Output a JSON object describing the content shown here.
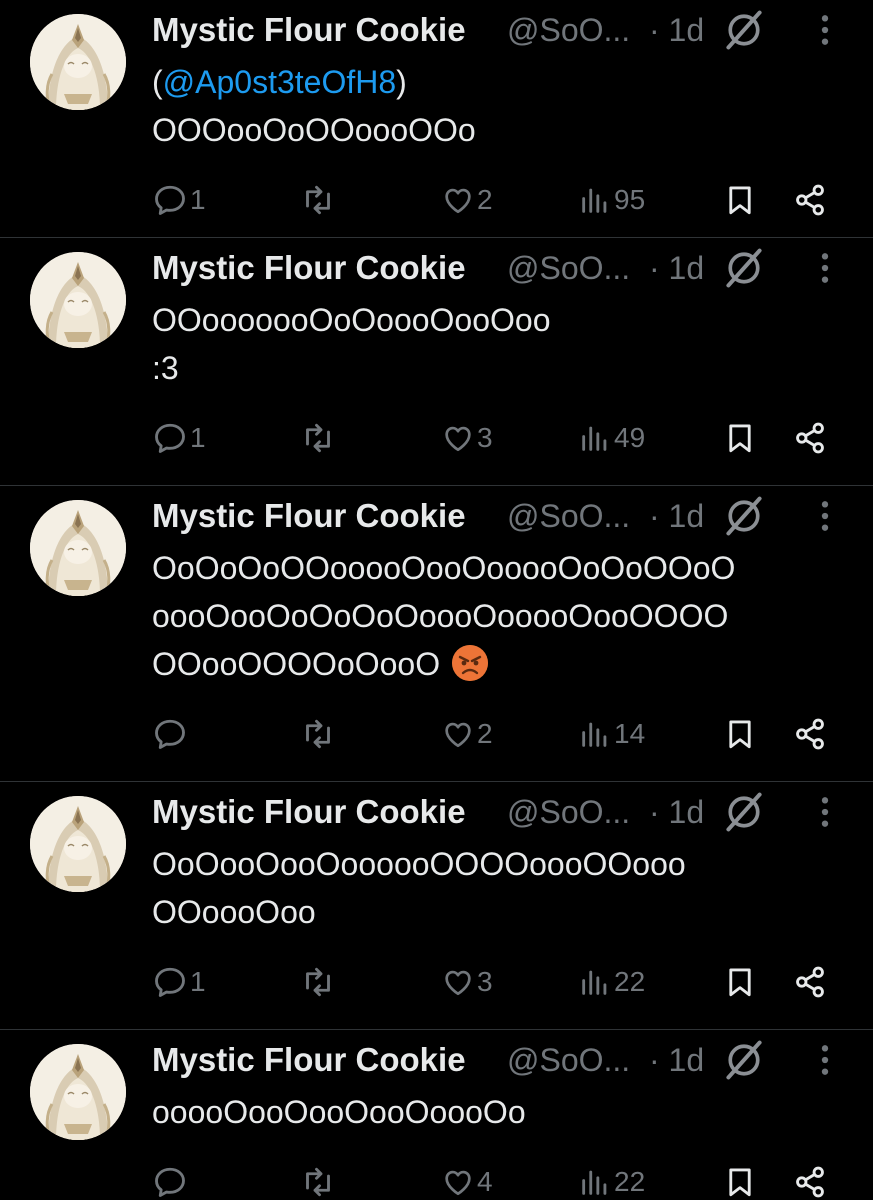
{
  "colors": {
    "background": "#000000",
    "text": "#e7e9ea",
    "muted": "#71767b",
    "mention": "#1d9bf0",
    "divider": "#2f3336"
  },
  "tweets": [
    {
      "name": "Mystic Flour Cookie",
      "handle": "@SoO...",
      "time": "· 1d",
      "lines": [
        {
          "prefix": "(",
          "mention": "@Ap0st3teOfH8",
          "suffix": ")"
        },
        {
          "text": "OOOooOoOOoooOOo"
        }
      ],
      "replies": "1",
      "retweets": "",
      "likes": "2",
      "views": "95"
    },
    {
      "name": "Mystic Flour Cookie",
      "handle": "@SoO...",
      "time": "· 1d",
      "lines": [
        {
          "text": "OOooooooOoOoooOooOoo"
        },
        {
          "text": ":3"
        }
      ],
      "replies": "1",
      "retweets": "",
      "likes": "3",
      "views": "49"
    },
    {
      "name": "Mystic Flour Cookie",
      "handle": "@SoO...",
      "time": "· 1d",
      "lines": [
        {
          "text": "OoOoOoOOooooOooOooooOoOoOOoO"
        },
        {
          "text": "oooOooOoOoOoOoooOooooOooOOOO"
        },
        {
          "text": "OOooOOOOoOooO",
          "emoji": "angry-face-emoji"
        }
      ],
      "replies": "",
      "retweets": "",
      "likes": "2",
      "views": "14"
    },
    {
      "name": "Mystic Flour Cookie",
      "handle": "@SoO...",
      "time": "· 1d",
      "lines": [
        {
          "text": "OoOooOooOoooooOOOOoooOOooo"
        },
        {
          "text": "OOoooOoo"
        }
      ],
      "replies": "1",
      "retweets": "",
      "likes": "3",
      "views": "22"
    },
    {
      "name": "Mystic Flour Cookie",
      "handle": "@SoO...",
      "time": "· 1d",
      "lines": [
        {
          "text": "ooooOooOooOooOoooOo"
        }
      ],
      "replies": "",
      "retweets": "",
      "likes": "4",
      "views": "22"
    }
  ],
  "icons": {
    "reply": "reply-icon",
    "retweet": "retweet-icon",
    "like": "heart-icon",
    "views": "views-icon",
    "bookmark": "bookmark-icon",
    "share": "share-icon",
    "grok": "grok-icon",
    "more": "more-icon"
  }
}
